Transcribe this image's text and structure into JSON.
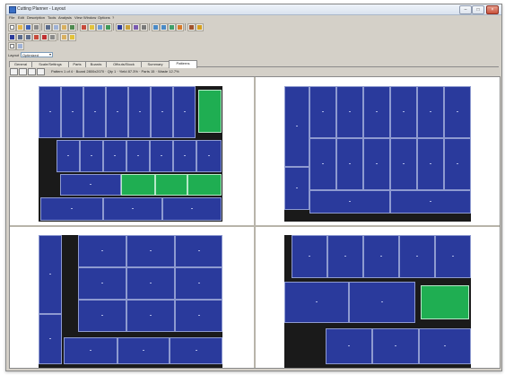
{
  "window": {
    "title": "Cutting Planner - Layout"
  },
  "menu": [
    "File",
    "Edit",
    "Description",
    "Tools",
    "Analysis",
    "View",
    "Window",
    "Options",
    "?"
  ],
  "options": {
    "label": "Layout",
    "select_value": "Optimized"
  },
  "tabs": [
    "General",
    "Scale/Settings",
    "Parts",
    "Boards",
    "Offcuts/Stock",
    "Summary",
    "Patterns"
  ],
  "active_tab": 6,
  "rowbar": {
    "text": "Pattern 1 of 4 · Board 2800x2070 · Qty 1 · Yield 87.3% · Parts 15 · Waste 12.7%"
  },
  "colors": {
    "panel_blue": "#2a3a9c",
    "highlight_green": "#1fae52",
    "waste_black": "#1a1a1a"
  },
  "layouts": [
    {
      "name": "layout-top-left",
      "sheet": [
        32,
        10,
        205,
        151
      ],
      "cells": [
        [
          32,
          10,
          25,
          58,
          "b"
        ],
        [
          57,
          10,
          25,
          58,
          "b"
        ],
        [
          82,
          10,
          25,
          58,
          "b"
        ],
        [
          107,
          10,
          25,
          58,
          "b"
        ],
        [
          132,
          10,
          25,
          58,
          "b"
        ],
        [
          157,
          10,
          25,
          58,
          "b"
        ],
        [
          182,
          10,
          25,
          58,
          "b"
        ],
        [
          210,
          14,
          26,
          48,
          "g"
        ],
        [
          32,
          70,
          20,
          36,
          "k"
        ],
        [
          52,
          70,
          26,
          36,
          "b"
        ],
        [
          78,
          70,
          26,
          36,
          "b"
        ],
        [
          104,
          70,
          26,
          36,
          "b"
        ],
        [
          130,
          70,
          26,
          36,
          "b"
        ],
        [
          156,
          70,
          26,
          36,
          "b"
        ],
        [
          182,
          70,
          26,
          36,
          "b"
        ],
        [
          208,
          70,
          28,
          36,
          "b"
        ],
        [
          32,
          108,
          22,
          24,
          "k"
        ],
        [
          56,
          108,
          68,
          24,
          "b"
        ],
        [
          124,
          108,
          38,
          24,
          "g"
        ],
        [
          162,
          108,
          36,
          24,
          "g"
        ],
        [
          198,
          108,
          38,
          24,
          "g"
        ],
        [
          34,
          134,
          70,
          26,
          "b"
        ],
        [
          104,
          134,
          66,
          26,
          "b"
        ],
        [
          170,
          134,
          66,
          26,
          "b"
        ]
      ]
    },
    {
      "name": "layout-top-right",
      "sheet": [
        306,
        10,
        208,
        151
      ],
      "cells": [
        [
          306,
          10,
          28,
          90,
          "b"
        ],
        [
          306,
          100,
          28,
          48,
          "b"
        ],
        [
          306,
          148,
          28,
          13,
          "k"
        ],
        [
          334,
          10,
          30,
          58,
          "b"
        ],
        [
          364,
          10,
          30,
          58,
          "b"
        ],
        [
          394,
          10,
          30,
          58,
          "b"
        ],
        [
          424,
          10,
          30,
          58,
          "b"
        ],
        [
          454,
          10,
          30,
          58,
          "b"
        ],
        [
          484,
          10,
          30,
          58,
          "b"
        ],
        [
          334,
          68,
          30,
          58,
          "b"
        ],
        [
          364,
          68,
          30,
          58,
          "b"
        ],
        [
          394,
          68,
          30,
          58,
          "b"
        ],
        [
          424,
          68,
          30,
          58,
          "b"
        ],
        [
          454,
          68,
          30,
          58,
          "b"
        ],
        [
          484,
          68,
          30,
          58,
          "b"
        ],
        [
          334,
          126,
          90,
          26,
          "b"
        ],
        [
          424,
          126,
          90,
          26,
          "b"
        ],
        [
          334,
          152,
          180,
          9,
          "k"
        ]
      ]
    },
    {
      "name": "layout-bottom-left",
      "sheet": [
        32,
        176,
        205,
        148
      ],
      "cells": [
        [
          32,
          176,
          26,
          88,
          "b"
        ],
        [
          32,
          264,
          26,
          56,
          "b"
        ],
        [
          32,
          320,
          26,
          4,
          "k"
        ],
        [
          58,
          176,
          18,
          140,
          "k"
        ],
        [
          76,
          176,
          54,
          36,
          "b"
        ],
        [
          130,
          176,
          54,
          36,
          "b"
        ],
        [
          184,
          176,
          53,
          36,
          "b"
        ],
        [
          76,
          212,
          54,
          36,
          "b"
        ],
        [
          130,
          212,
          54,
          36,
          "b"
        ],
        [
          184,
          212,
          53,
          36,
          "b"
        ],
        [
          76,
          248,
          54,
          36,
          "b"
        ],
        [
          130,
          248,
          54,
          36,
          "b"
        ],
        [
          184,
          248,
          53,
          36,
          "b"
        ],
        [
          60,
          290,
          60,
          30,
          "b"
        ],
        [
          120,
          290,
          58,
          30,
          "b"
        ],
        [
          178,
          290,
          59,
          30,
          "b"
        ]
      ]
    },
    {
      "name": "layout-bottom-right",
      "sheet": [
        306,
        176,
        208,
        148
      ],
      "cells": [
        [
          306,
          176,
          8,
          48,
          "k"
        ],
        [
          314,
          176,
          40,
          48,
          "b"
        ],
        [
          354,
          176,
          40,
          48,
          "b"
        ],
        [
          394,
          176,
          40,
          48,
          "b"
        ],
        [
          434,
          176,
          40,
          48,
          "b"
        ],
        [
          474,
          176,
          40,
          48,
          "b"
        ],
        [
          306,
          228,
          72,
          46,
          "b"
        ],
        [
          378,
          228,
          74,
          46,
          "b"
        ],
        [
          458,
          232,
          54,
          38,
          "g"
        ],
        [
          306,
          280,
          46,
          44,
          "k"
        ],
        [
          352,
          280,
          52,
          40,
          "b"
        ],
        [
          404,
          280,
          52,
          40,
          "b"
        ],
        [
          456,
          280,
          58,
          40,
          "b"
        ]
      ]
    }
  ]
}
